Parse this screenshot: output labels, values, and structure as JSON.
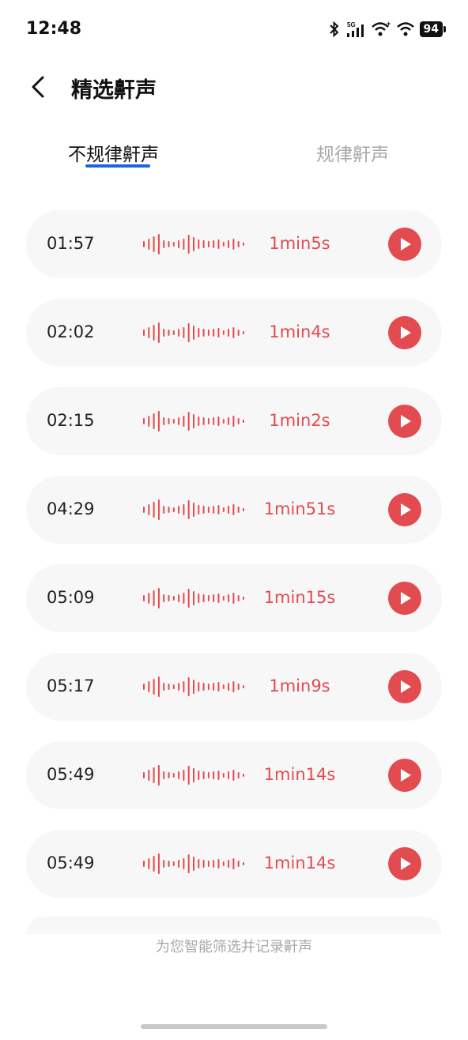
{
  "status_bar": {
    "time": "12:48",
    "battery": "94",
    "network": "5G"
  },
  "header": {
    "title": "精选鼾声"
  },
  "tabs": [
    {
      "label": "不规律鼾声"
    },
    {
      "label": "规律鼾声"
    }
  ],
  "recordings": [
    {
      "time": "01:57",
      "duration": "1min5s"
    },
    {
      "time": "02:02",
      "duration": "1min4s"
    },
    {
      "time": "02:15",
      "duration": "1min2s"
    },
    {
      "time": "04:29",
      "duration": "1min51s"
    },
    {
      "time": "05:09",
      "duration": "1min15s"
    },
    {
      "time": "05:17",
      "duration": "1min9s"
    },
    {
      "time": "05:49",
      "duration": "1min14s"
    },
    {
      "time": "05:49",
      "duration": "1min14s"
    }
  ],
  "footer": {
    "text": "为您智能筛选并记录鼾声"
  },
  "colors": {
    "accent": "#e24b4f",
    "tab_indicator": "#1a64e6"
  },
  "icons": [
    "bluetooth-icon",
    "signal-icon",
    "wifi-icon",
    "back-arrow-icon",
    "waveform-icon",
    "play-icon"
  ]
}
